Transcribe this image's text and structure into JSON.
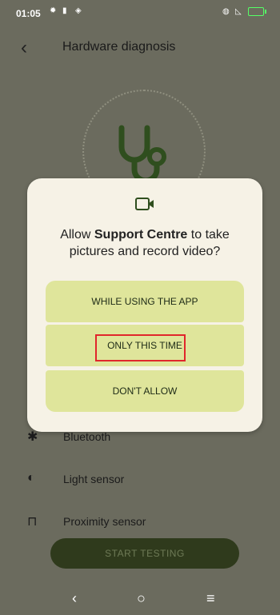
{
  "status": {
    "time": "01:05"
  },
  "appbar": {
    "title": "Hardware diagnosis"
  },
  "list": [
    {
      "label": "Bluetooth",
      "icon": "bluetooth-icon"
    },
    {
      "label": "Light sensor",
      "icon": "light-sensor-icon"
    },
    {
      "label": "Proximity sensor",
      "icon": "proximity-icon"
    }
  ],
  "start_button": {
    "label": "START TESTING"
  },
  "dialog": {
    "prefix": "Allow ",
    "app": "Support Centre",
    "suffix": " to take pictures and record video?",
    "options": {
      "while_using": "WHILE USING THE APP",
      "only_this_time": "ONLY THIS TIME",
      "dont_allow": "DON'T ALLOW"
    }
  },
  "colors": {
    "background": "#6b6b5e",
    "dialog_bg": "#f6f2e6",
    "option_bg": "#dfe59b",
    "highlight": "#e0262b",
    "start_bg": "#2f3a1c"
  }
}
